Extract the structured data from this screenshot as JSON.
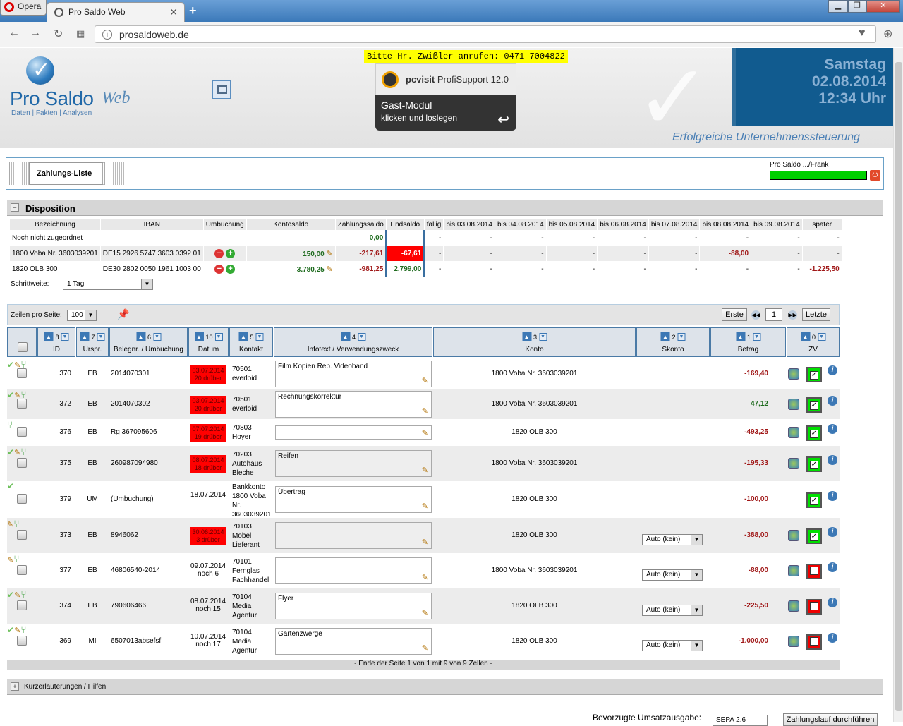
{
  "browser": {
    "menu_label": "Opera",
    "tab_title": "Pro Saldo Web",
    "url": "prosaldoweb.de"
  },
  "header": {
    "logo_name": "Pro Saldo",
    "logo_web": "Web",
    "logo_subtitle": "Daten | Fakten | Analysen",
    "call_note": "Bitte Hr. Zwißler anrufen: 0471 7004822",
    "pcvisit_brand": "pcvisit",
    "pcvisit_product": "ProfiSupport 12.0",
    "guest_title": "Gast-Modul",
    "guest_sub": "klicken und loslegen",
    "weekday": "Samstag",
    "date": "02.08.2014",
    "time": "12:34 Uhr",
    "slogan": "Erfolgreiche Unternehmenssteuerung"
  },
  "tabpanel": {
    "active_tab": "Zahlungs-Liste",
    "user": "Pro Saldo .../Frank"
  },
  "disposition": {
    "title": "Disposition",
    "headers": [
      "Bezeichnung",
      "IBAN",
      "Umbuchung",
      "Kontosaldo",
      "Zahlungssaldo",
      "Endsaldo",
      "fällig",
      "bis 03.08.2014",
      "bis 04.08.2014",
      "bis 05.08.2014",
      "bis 06.08.2014",
      "bis 07.08.2014",
      "bis 08.08.2014",
      "bis 09.08.2014",
      "später"
    ],
    "rows": [
      {
        "name": "Noch nicht zugeordnet",
        "iban": "",
        "konto": "",
        "zahlung": "0,00",
        "end": "",
        "cells": [
          "-",
          "-",
          "-",
          "-",
          "-",
          "-",
          "-",
          "-",
          "-"
        ]
      },
      {
        "name": "1800 Voba Nr. 3603039201",
        "iban": "DE15 2926 5747 3603 0392 01",
        "konto": "150,00",
        "zahlung": "-217,61",
        "end": "-67,61",
        "cells": [
          "-",
          "-",
          "-",
          "-",
          "-",
          "-",
          "-88,00",
          "-",
          "-"
        ]
      },
      {
        "name": "1820 OLB 300",
        "iban": "DE30 2802 0050 1961 1003 00",
        "konto": "3.780,25",
        "zahlung": "-981,25",
        "end": "2.799,00",
        "cells": [
          "-",
          "-",
          "-",
          "-",
          "-",
          "-",
          "-",
          "-",
          "-1.225,50"
        ]
      }
    ],
    "step_label": "Schrittweite:",
    "step_value": "1 Tag"
  },
  "list": {
    "rows_label": "Zeilen pro Seite:",
    "rows_value": "100",
    "first_btn": "Erste",
    "page": "1",
    "last_btn": "Letzte",
    "columns": [
      {
        "label": "ID",
        "order": "8"
      },
      {
        "label": "Urspr.",
        "order": "7"
      },
      {
        "label": "Belegnr. / Umbuchung",
        "order": "6"
      },
      {
        "label": "Datum",
        "order": "10"
      },
      {
        "label": "Kontakt",
        "order": "5"
      },
      {
        "label": "Infotext / Verwendungszweck",
        "order": "4"
      },
      {
        "label": "Konto",
        "order": "3"
      },
      {
        "label": "Skonto",
        "order": "2"
      },
      {
        "label": "Betrag",
        "order": "1"
      },
      {
        "label": "ZV",
        "order": "0"
      }
    ],
    "rows": [
      {
        "id": "370",
        "src": "EB",
        "beleg": "2014070301",
        "date1": "03.07.2014",
        "date2": "20 drüber",
        "bad": true,
        "contact": "70501\neverloid",
        "info": "Film Kopien Rep. Videoband",
        "konto": "1800 Voba Nr. 3603039201",
        "skonto": "",
        "amount": "-169,40",
        "neg": true,
        "zv": true
      },
      {
        "id": "372",
        "src": "EB",
        "beleg": "2014070302",
        "date1": "03.07.2014",
        "date2": "20 drüber",
        "bad": true,
        "contact": "70501\neverloid",
        "info": "Rechnungskorrektur",
        "konto": "1800 Voba Nr. 3603039201",
        "skonto": "",
        "amount": "47,12",
        "neg": false,
        "zv": true
      },
      {
        "id": "376",
        "src": "EB",
        "beleg": "Rg 367095606",
        "date1": "07.07.2014",
        "date2": "19 drüber",
        "bad": true,
        "contact": "70803\nHoyer",
        "info": "",
        "konto": "1820 OLB 300",
        "skonto": "",
        "amount": "-493,25",
        "neg": true,
        "zv": true
      },
      {
        "id": "375",
        "src": "EB",
        "beleg": "260987094980",
        "date1": "08.07.2014",
        "date2": "18 drüber",
        "bad": true,
        "contact": "70203\nAutohaus\nBleche",
        "info": "Reifen",
        "konto": "1800 Voba Nr. 3603039201",
        "skonto": "",
        "amount": "-195,33",
        "neg": true,
        "zv": true
      },
      {
        "id": "379",
        "src": "UM",
        "beleg": "(Umbuchung)",
        "date1": "18.07.2014",
        "date2": "",
        "bad": false,
        "contact": "Bankkonto\n1800 Voba\nNr.\n3603039201",
        "info": "Übertrag",
        "konto": "1820 OLB 300",
        "skonto": "",
        "amount": "-100,00",
        "neg": true,
        "zv": true
      },
      {
        "id": "373",
        "src": "EB",
        "beleg": "8946062",
        "date1": "30.06.2014",
        "date2": "3 drüber",
        "bad": true,
        "contact": "70103\nMöbel\nLieferant",
        "info": "",
        "konto": "1820 OLB 300",
        "skonto": "Auto (kein)",
        "amount": "-388,00",
        "neg": true,
        "zv": true
      },
      {
        "id": "377",
        "src": "EB",
        "beleg": "46806540-2014",
        "date1": "09.07.2014",
        "date2": "noch 6",
        "bad": false,
        "contact": "70101\nFernglas\nFachhandel",
        "info": "",
        "konto": "1800 Voba Nr. 3603039201",
        "skonto": "Auto (kein)",
        "amount": "-88,00",
        "neg": true,
        "zv": false
      },
      {
        "id": "374",
        "src": "EB",
        "beleg": "790606466",
        "date1": "08.07.2014",
        "date2": "noch 15",
        "bad": false,
        "contact": "70104\nMedia\nAgentur",
        "info": "Flyer",
        "konto": "1820 OLB 300",
        "skonto": "Auto (kein)",
        "amount": "-225,50",
        "neg": true,
        "zv": false
      },
      {
        "id": "369",
        "src": "MI",
        "beleg": "6507013absefsf",
        "date1": "10.07.2014",
        "date2": "noch 17",
        "bad": false,
        "contact": "70104\nMedia\nAgentur",
        "info": "Gartenzwerge",
        "konto": "1820 OLB 300",
        "skonto": "Auto (kein)",
        "amount": "-1.000,00",
        "neg": true,
        "zv": false
      }
    ],
    "footer": "- Ende der Seite 1 von 1 mit 9 von 9 Zellen -"
  },
  "help_title": "Kurzerläuterungen / Hilfen",
  "bottom": {
    "tax_label": "Bevorzugte Umsatzausgabe:",
    "tax_value": "SEPA 2.6",
    "run_btn": "Zahlungslauf durchführen"
  }
}
